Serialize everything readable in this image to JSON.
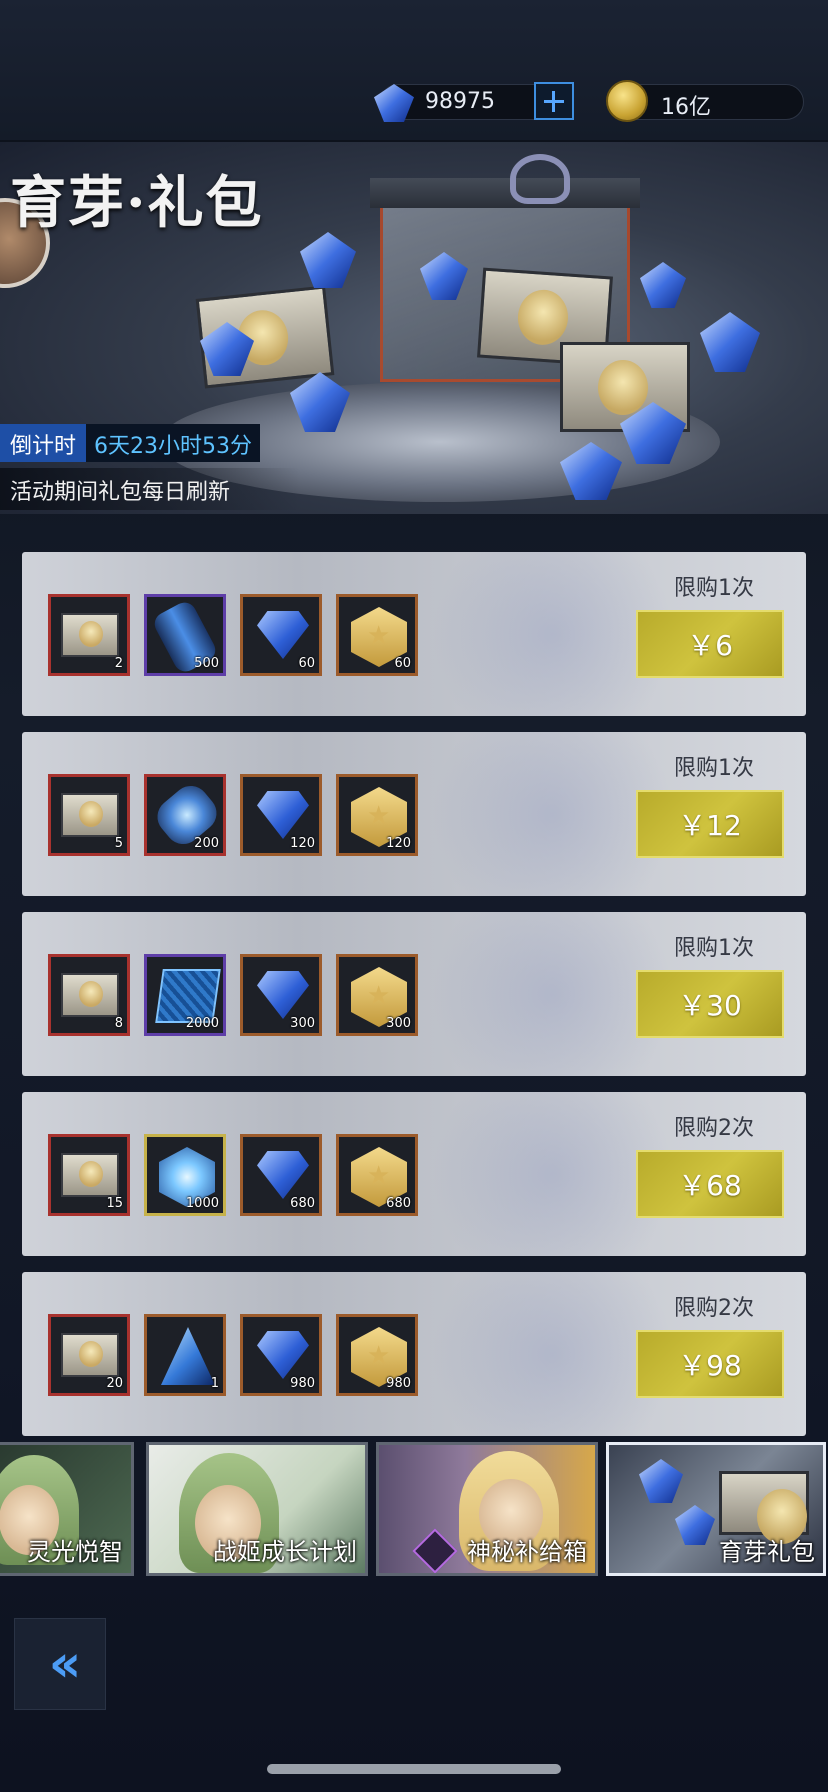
{
  "currency": {
    "gems": "98975",
    "gold": "16亿"
  },
  "banner": {
    "title": "育芽·礼包",
    "countdown_label": "倒计时",
    "countdown_value": "6天23小时53分",
    "notice": "活动期间礼包每日刷新"
  },
  "packs": [
    {
      "limit": "限购1次",
      "price": "￥6",
      "items": [
        {
          "icon": "ticket-icon",
          "count": "2"
        },
        {
          "icon": "energy-cell-icon",
          "count": "500"
        },
        {
          "icon": "blue-gem-icon",
          "count": "60"
        },
        {
          "icon": "gold-hex-icon",
          "count": "60"
        }
      ]
    },
    {
      "limit": "限购1次",
      "price": "￥12",
      "items": [
        {
          "icon": "ticket-icon",
          "count": "5"
        },
        {
          "icon": "energy-core-icon",
          "count": "200"
        },
        {
          "icon": "blue-gem-icon",
          "count": "120"
        },
        {
          "icon": "gold-hex-icon",
          "count": "120"
        }
      ]
    },
    {
      "limit": "限购1次",
      "price": "￥30",
      "items": [
        {
          "icon": "ticket-icon",
          "count": "8"
        },
        {
          "icon": "chip-icon",
          "count": "2000"
        },
        {
          "icon": "blue-gem-icon",
          "count": "300"
        },
        {
          "icon": "gold-hex-icon",
          "count": "300"
        }
      ]
    },
    {
      "limit": "限购2次",
      "price": "￥68",
      "items": [
        {
          "icon": "ticket-icon",
          "count": "15"
        },
        {
          "icon": "crystal-orb-icon",
          "count": "1000"
        },
        {
          "icon": "blue-gem-icon",
          "count": "680"
        },
        {
          "icon": "gold-hex-icon",
          "count": "680"
        }
      ]
    },
    {
      "limit": "限购2次",
      "price": "￥98",
      "items": [
        {
          "icon": "ticket-icon",
          "count": "20"
        },
        {
          "icon": "prism-icon",
          "count": "1"
        },
        {
          "icon": "blue-gem-icon",
          "count": "980"
        },
        {
          "icon": "gold-hex-icon",
          "count": "980"
        }
      ]
    }
  ],
  "tabs": [
    {
      "label": "灵光悦智"
    },
    {
      "label": "战姬成长计划"
    },
    {
      "label": "神秘补给箱"
    },
    {
      "label": "育芽礼包",
      "active": true
    }
  ],
  "colors": {
    "price_button": "#c4b736",
    "countdown_accent": "#5ec3ff",
    "plus_button": "#3e8fe0"
  }
}
